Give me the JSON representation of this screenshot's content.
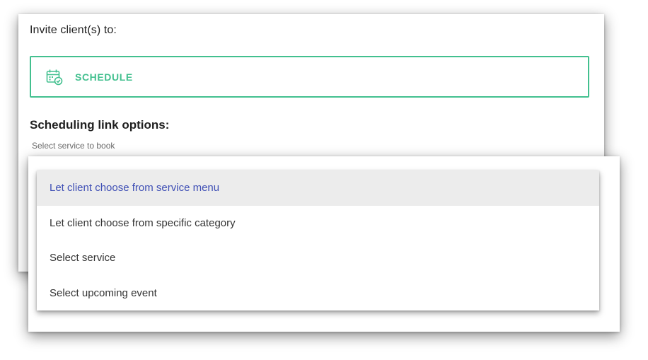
{
  "invite": {
    "title": "Invite client(s) to:",
    "schedule_label": "SCHEDULE",
    "schedule_icon": "calendar-check-icon"
  },
  "scheduling": {
    "title": "Scheduling link options:",
    "caption": "Select service to book"
  },
  "dropdown": {
    "options": [
      {
        "label": "Let client choose from service menu",
        "selected": true
      },
      {
        "label": "Let client choose from specific category",
        "selected": false
      },
      {
        "label": "Select service",
        "selected": false
      },
      {
        "label": "Select upcoming event",
        "selected": false
      }
    ]
  },
  "colors": {
    "accent": "#43c08f",
    "selected_text": "#3f4fb5",
    "selected_bg": "#ececec"
  }
}
